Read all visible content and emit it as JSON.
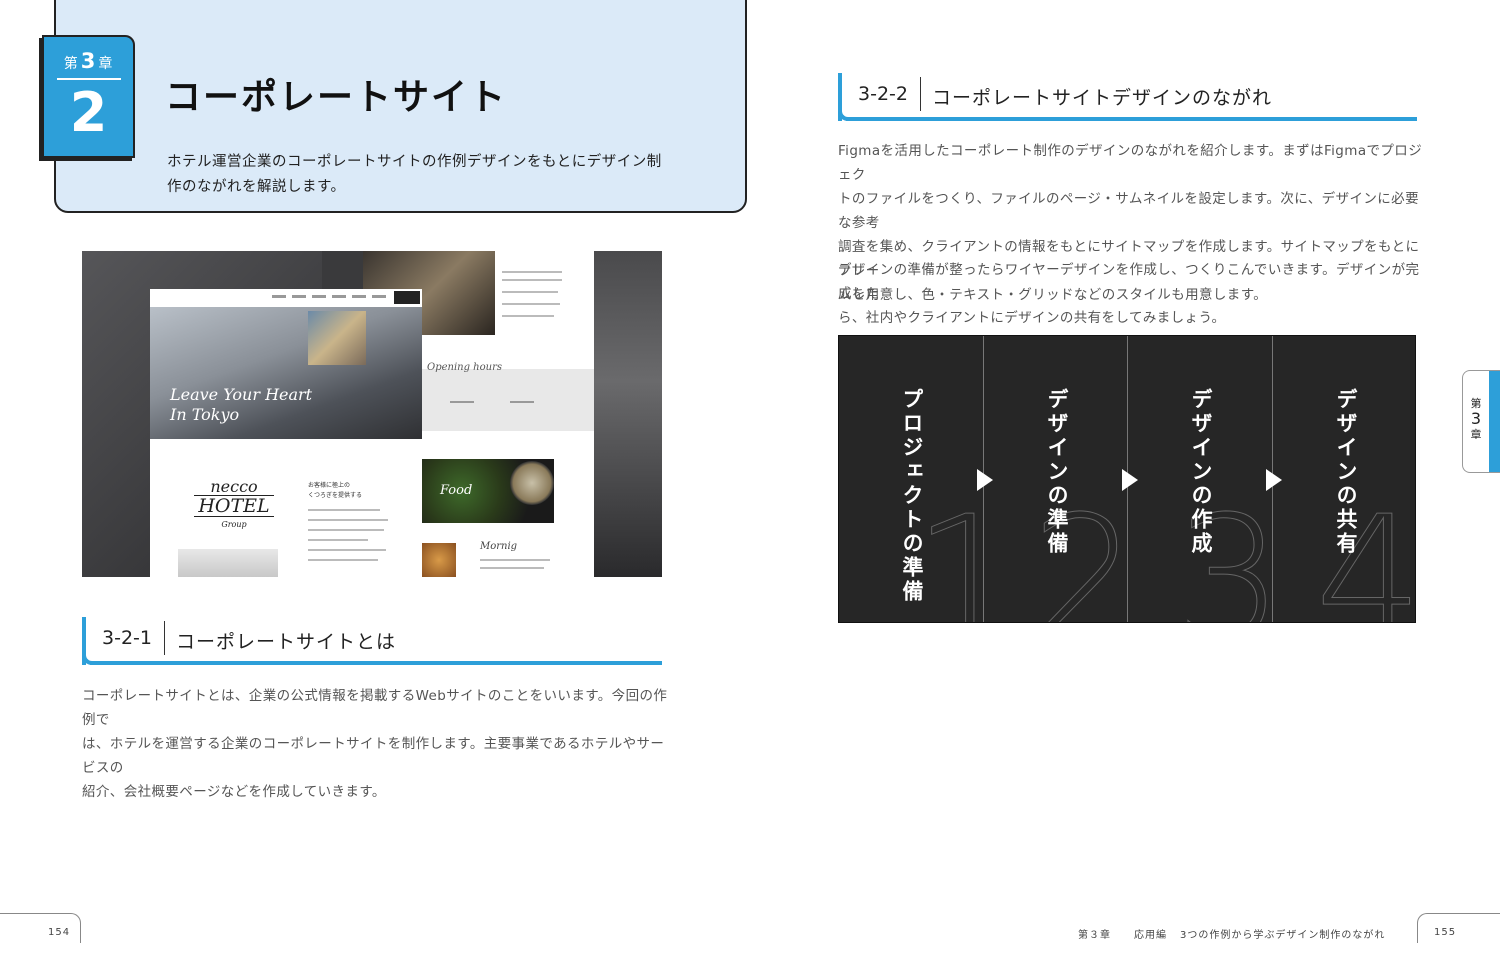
{
  "chapter": {
    "label_prefix": "第",
    "number": "3",
    "label_suffix": "章",
    "section_number": "2",
    "title": "コーポレートサイト",
    "description_line1": "ホテル運営企業のコーポレートサイトの作例デザインをもとにデザイン制",
    "description_line2": "作のながれを解説します。"
  },
  "mockup": {
    "hero_line1": "Leave Your Heart",
    "hero_line2": "In Tokyo",
    "logo_line1": "necco",
    "logo_line2": "HOTEL",
    "logo_line3": "Group",
    "jp_heading_line1": "お客様に極上の",
    "jp_heading_line2": "くつろぎを提供する",
    "opening_hours": "Opening hours",
    "food_label": "Food",
    "mornig_label": "Mornig"
  },
  "section1": {
    "number": "3-2-1",
    "title": "コーポレートサイトとは",
    "para_lines": [
      "コーポレートサイトとは、企業の公式情報を掲載するWebサイトのことをいいます。今回の作例で",
      "は、ホテルを運営する企業のコーポレートサイトを制作します。主要事業であるホテルやサービスの",
      "紹介、会社概要ページなどを作成していきます。"
    ]
  },
  "section2": {
    "number": "3-2-2",
    "title": "コーポレートサイトデザインのながれ",
    "para1_lines": [
      "Figmaを活用したコーポレート制作のデザインのながれを紹介します。まずはFigmaでプロジェク",
      "トのファイルをつくり、ファイルのページ・サムネイルを設定します。次に、デザインに必要な参考",
      "調査を集め、クライアントの情報をもとにサイトマップを作成します。サイトマップをもとにフレー",
      "ムを用意し、色・テキスト・グリッドなどのスタイルも用意します。"
    ],
    "para2_lines": [
      "デザインの準備が整ったらワイヤーデザインを作成し、つくりこんでいきます。デザインが完成した",
      "ら、社内やクライアントにデザインの共有をしてみましょう。"
    ]
  },
  "flow": {
    "steps": [
      {
        "number": "1",
        "label": "プロジェクトの準備"
      },
      {
        "number": "2",
        "label": "デザインの準備"
      },
      {
        "number": "3",
        "label": "デザインの作成"
      },
      {
        "number": "4",
        "label": "デザインの共有"
      }
    ]
  },
  "side_tab": {
    "prefix": "第",
    "number": "3",
    "suffix": "章"
  },
  "footer": {
    "left_page": "154",
    "right_page": "155",
    "chapter": "第３章",
    "section": "応用編",
    "running_title": "3つの作例から学ぶデザイン制作のながれ"
  },
  "colors": {
    "accent": "#2d9fd9",
    "header_bg": "#dbeaf8",
    "flow_bg": "#262626"
  }
}
